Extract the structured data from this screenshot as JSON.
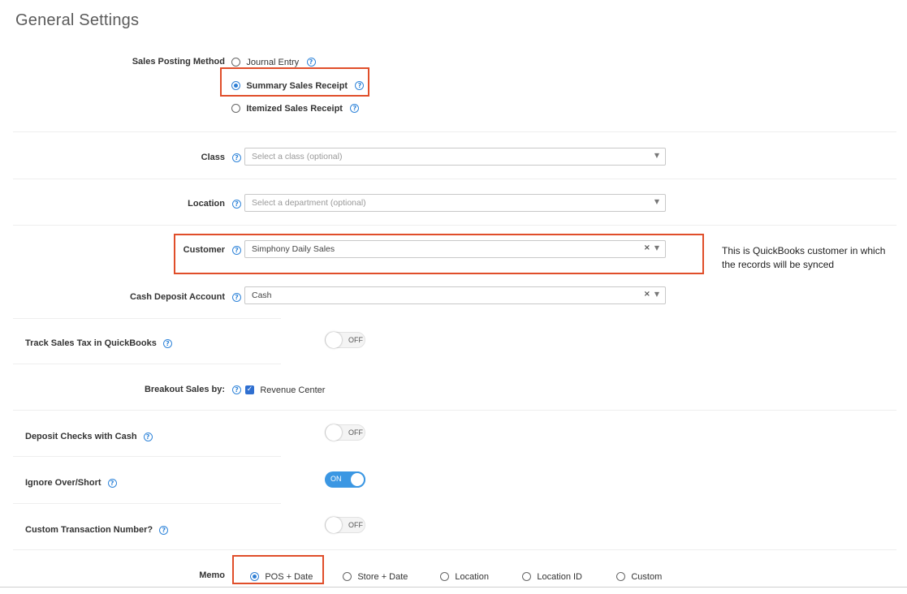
{
  "page_title": "General Settings",
  "sales_posting": {
    "label": "Sales Posting Method",
    "options": [
      {
        "label": "Journal Entry",
        "selected": false
      },
      {
        "label": "Summary Sales Receipt",
        "selected": true
      },
      {
        "label": "Itemized Sales Receipt",
        "selected": false
      }
    ]
  },
  "class_field": {
    "label": "Class",
    "placeholder": "Select a class (optional)"
  },
  "location_field": {
    "label": "Location",
    "placeholder": "Select a department (optional)"
  },
  "customer_field": {
    "label": "Customer",
    "value": "Simphony Daily Sales"
  },
  "customer_note": {
    "line1": "This is QuickBooks customer in which",
    "line2": "the records will be synced"
  },
  "cash_deposit_field": {
    "label": "Cash Deposit Account",
    "value": "Cash"
  },
  "track_sales_tax": {
    "label": "Track Sales Tax in QuickBooks",
    "state": "OFF"
  },
  "breakout_sales": {
    "label": "Breakout Sales by:",
    "option": "Revenue Center",
    "checked": true
  },
  "deposit_checks": {
    "label": "Deposit Checks with Cash",
    "state": "OFF"
  },
  "ignore_over_short": {
    "label": "Ignore Over/Short",
    "state": "ON"
  },
  "custom_txn_number": {
    "label": "Custom Transaction Number?",
    "state": "OFF"
  },
  "memo": {
    "label": "Memo",
    "options": [
      {
        "label": "POS + Date",
        "selected": true
      },
      {
        "label": "Store + Date",
        "selected": false
      },
      {
        "label": "Location",
        "selected": false
      },
      {
        "label": "Location ID",
        "selected": false
      },
      {
        "label": "Custom",
        "selected": false
      }
    ]
  },
  "icons": {
    "help": "question-circle-icon",
    "caret": "caret-down-icon",
    "clear": "clear-x-icon",
    "check": "checkmark-icon"
  },
  "colors": {
    "accent": "#2f7fd4",
    "highlight_box": "#e04e2a",
    "toggle_on": "#3b97e3"
  }
}
